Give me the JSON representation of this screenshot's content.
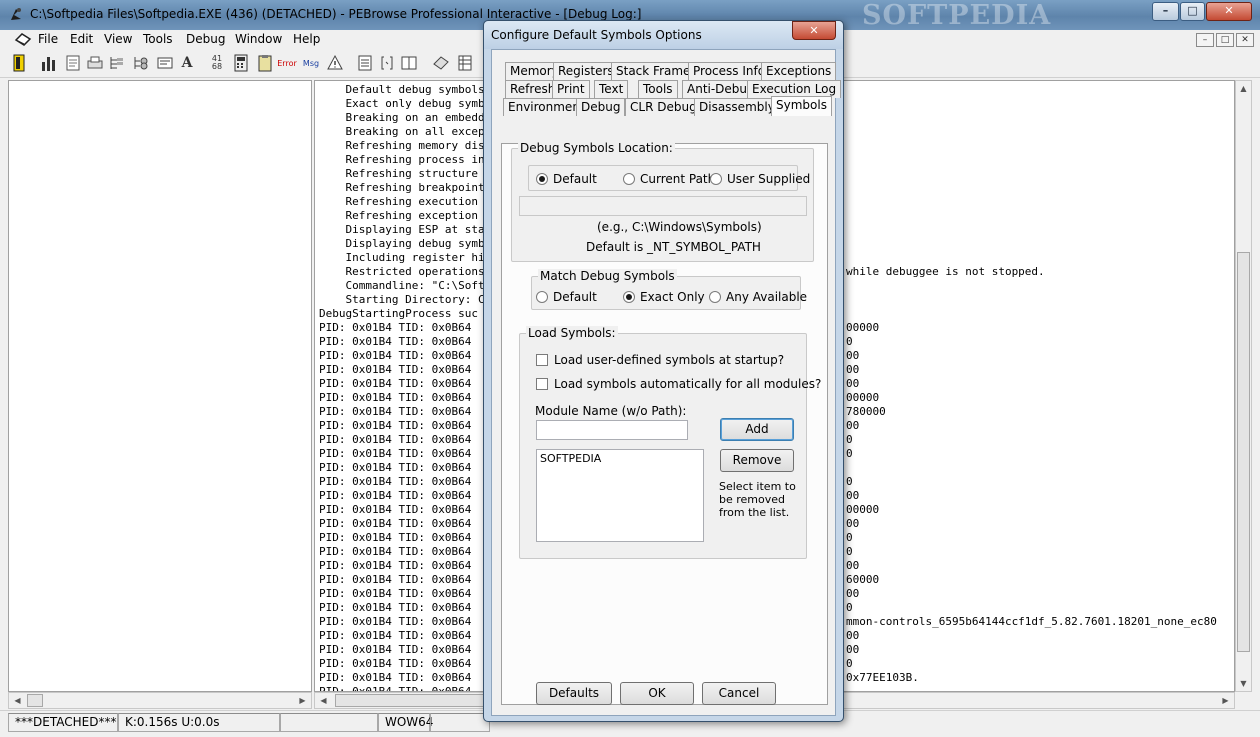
{
  "window": {
    "title": "C:\\Softpedia Files\\Softpedia.EXE (436) (DETACHED) - PEBrowse Professional Interactive - [Debug Log:]",
    "watermark": "SOFTPEDIA",
    "min_glyph": "–",
    "max_glyph": "□",
    "close_glyph": "✕"
  },
  "menu": {
    "items": [
      "File",
      "Edit",
      "View",
      "Tools",
      "Debug",
      "Window",
      "Help"
    ],
    "mdi": [
      "–",
      "□",
      "✕"
    ]
  },
  "toolbar": {
    "icons": [
      "exit-icon",
      "chart-icon",
      "doc-icon",
      "print-icon",
      "tree-icon",
      "tree2-icon",
      "text-icon",
      "font-icon",
      "hex-icon",
      "calc-icon",
      "clipboard-icon",
      "error-msg-icon",
      "msg-icon",
      "warning-icon",
      "list-icon",
      "brackets-icon",
      "split-icon",
      "bookmark-icon",
      "grid-icon"
    ],
    "labels": {
      "hex": "41\n68",
      "font": "A",
      "error": "Error",
      "msg": "Msg"
    }
  },
  "log": {
    "lines": [
      "    Default debug symbols",
      "    Exact only debug symbo",
      "    Breaking on an embedde",
      "    Breaking on all except",
      "    Refreshing memory disp",
      "    Refreshing process inf",
      "    Refreshing structure d",
      "    Refreshing breakpoint",
      "    Refreshing execution p",
      "    Refreshing exception l",
      "    Displaying ESP at star",
      "    Displaying debug symbo",
      "    Including register hin",
      "    Restricted operations",
      "    Commandline: \"C:\\Softp",
      "    Starting Directory: C",
      "DebugStartingProcess suc",
      "PID: 0x01B4 TID: 0x0B64",
      "PID: 0x01B4 TID: 0x0B64",
      "PID: 0x01B4 TID: 0x0B64",
      "PID: 0x01B4 TID: 0x0B64",
      "PID: 0x01B4 TID: 0x0B64",
      "PID: 0x01B4 TID: 0x0B64",
      "PID: 0x01B4 TID: 0x0B64",
      "PID: 0x01B4 TID: 0x0B64",
      "PID: 0x01B4 TID: 0x0B64",
      "PID: 0x01B4 TID: 0x0B64",
      "PID: 0x01B4 TID: 0x0B64",
      "PID: 0x01B4 TID: 0x0B64",
      "PID: 0x01B4 TID: 0x0B64",
      "PID: 0x01B4 TID: 0x0B64",
      "PID: 0x01B4 TID: 0x0B64",
      "PID: 0x01B4 TID: 0x0B64",
      "PID: 0x01B4 TID: 0x0B64",
      "PID: 0x01B4 TID: 0x0B64",
      "PID: 0x01B4 TID: 0x0B64",
      "PID: 0x01B4 TID: 0x0B64",
      "PID: 0x01B4 TID: 0x0B64",
      "PID: 0x01B4 TID: 0x0B64",
      "PID: 0x01B4 TID: 0x0B64",
      "PID: 0x01B4 TID: 0x0B64",
      "PID: 0x01B4 TID: 0x0B64",
      "PID: 0x01B4 TID: 0x0B64",
      "PID: 0x01B4 TID: 0x0B64",
      "PID: 0x01B4 TID: 0x0B64"
    ],
    "right_fragments": [
      {
        "row": 13,
        "text": "while debuggee is not stopped."
      },
      {
        "row": 17,
        "text": "00000"
      },
      {
        "row": 18,
        "text": "0"
      },
      {
        "row": 19,
        "text": "00"
      },
      {
        "row": 20,
        "text": "00"
      },
      {
        "row": 21,
        "text": "00"
      },
      {
        "row": 22,
        "text": "00000"
      },
      {
        "row": 23,
        "text": "780000"
      },
      {
        "row": 24,
        "text": "00"
      },
      {
        "row": 25,
        "text": "0"
      },
      {
        "row": 26,
        "text": "0"
      },
      {
        "row": 28,
        "text": "0"
      },
      {
        "row": 29,
        "text": "00"
      },
      {
        "row": 30,
        "text": "00000"
      },
      {
        "row": 31,
        "text": "00"
      },
      {
        "row": 32,
        "text": "0"
      },
      {
        "row": 33,
        "text": "0"
      },
      {
        "row": 34,
        "text": "00"
      },
      {
        "row": 35,
        "text": "60000"
      },
      {
        "row": 36,
        "text": "00"
      },
      {
        "row": 37,
        "text": "0"
      },
      {
        "row": 38,
        "text": "mmon-controls_6595b64144ccf1df_5.82.7601.18201_none_ec80"
      },
      {
        "row": 39,
        "text": "00"
      },
      {
        "row": 40,
        "text": "00"
      },
      {
        "row": 41,
        "text": "0"
      },
      {
        "row": 42,
        "text": "0x77EE103B."
      }
    ]
  },
  "status": {
    "cells": [
      "***DETACHED***",
      "K:0.156s U:0.0s",
      "",
      "WOW64",
      ""
    ]
  },
  "dialog": {
    "title": "Configure Default Symbols Options",
    "close_glyph": "✕",
    "tabs_row1": [
      "Memory",
      "Registers",
      "Stack Frames",
      "Process Info",
      "Exceptions"
    ],
    "tabs_row2": [
      "Refresh",
      "Print",
      "Text",
      "Tools",
      "Anti-Debug",
      "Execution Log"
    ],
    "tabs_row3": [
      "Environment",
      "Debug",
      "CLR Debug",
      "Disassembly",
      "Symbols"
    ],
    "active_tab": "Symbols",
    "location": {
      "group_label": "Debug Symbols Location:",
      "options": [
        "Default",
        "Current Path",
        "User Supplied"
      ],
      "selected": "Default",
      "path_value": "",
      "example": "(e.g., C:\\Windows\\Symbols)",
      "default_note": "Default is _NT_SYMBOL_PATH"
    },
    "match": {
      "group_label": "Match Debug Symbols",
      "options": [
        "Default",
        "Exact Only",
        "Any Available"
      ],
      "selected": "Exact Only"
    },
    "load": {
      "group_label": "Load Symbols:",
      "check1": "Load user-defined symbols at startup?",
      "check2": "Load symbols automatically for all modules?",
      "check1_checked": false,
      "check2_checked": false,
      "module_label": "Module Name (w/o Path):",
      "module_value": "",
      "add_label": "Add",
      "remove_label": "Remove",
      "list_items": [
        "SOFTPEDIA"
      ],
      "hint": "Select item to be removed from the list."
    },
    "buttons": {
      "defaults": "Defaults",
      "ok": "OK",
      "cancel": "Cancel"
    }
  }
}
